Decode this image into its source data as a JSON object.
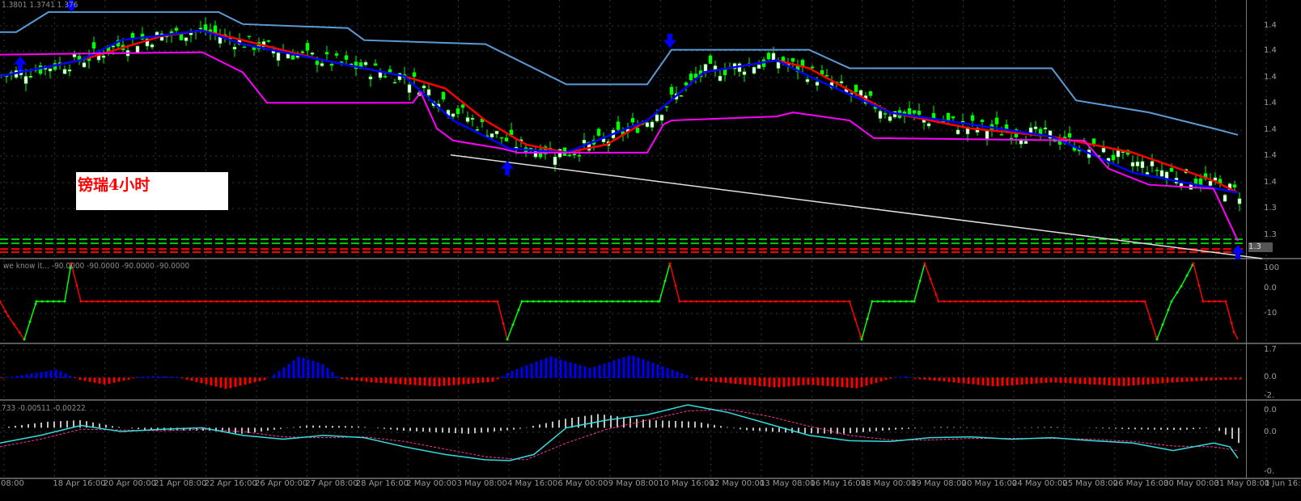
{
  "header": {
    "ohlc_text": "1.3801 1.3741 1.376"
  },
  "annotation": {
    "text": "镑瑞4小时"
  },
  "price_axis": {
    "labels": [
      "1.4",
      "1.4",
      "1.4",
      "1.4",
      "1.4",
      "1.4",
      "1.4",
      "1.3",
      "1.3"
    ],
    "current_price": "1.3"
  },
  "subwindow1": {
    "label": "we know it... -90.0000 -90.0000 -90.0000 -90.0000",
    "axis": [
      "100",
      "0.0",
      "-10"
    ]
  },
  "subwindow2": {
    "axis": [
      "1.7",
      "0.0",
      "-2."
    ]
  },
  "subwindow3": {
    "label": "733 -0.00511 -0.00222",
    "axis": [
      "0.0",
      "0.0",
      "-0."
    ]
  },
  "time_axis": [
    "08:00",
    "18 Apr 16:00",
    "20 Apr 00:00",
    "21 Apr 08:00",
    "22 Apr 16:00",
    "26 Apr 00:00",
    "27 Apr 08:00",
    "28 Apr 16:00",
    "2 May 00:00",
    "3 May 08:00",
    "4 May 16:00",
    "6 May 00:00",
    "9 May 08:00",
    "10 May 16:00",
    "12 May 00:00",
    "13 May 08:00",
    "16 May 16:00",
    "18 May 00:00",
    "19 May 08:00",
    "20 May 16:00",
    "24 May 00:00",
    "25 May 08:00",
    "26 May 16:00",
    "30 May 00:00",
    "31 May 08:00",
    "1 Jun 16:"
  ],
  "colors": {
    "upper_band": "#5b9bd5",
    "ma_fast": "#ff0000",
    "ma_slow": "#0000ff",
    "lower_band": "#ff00ff",
    "trendline": "#e0e0e0",
    "bull": "#00ff00",
    "bear": "#ffffff"
  },
  "chart_data": {
    "type": "line",
    "x_unit": "bar index",
    "series": [
      {
        "name": "upper_band",
        "points": [
          [
            0,
            1.422
          ],
          [
            2,
            1.422
          ],
          [
            6,
            1.427
          ],
          [
            27,
            1.427
          ],
          [
            30,
            1.424
          ],
          [
            43,
            1.423
          ],
          [
            45,
            1.42
          ],
          [
            60,
            1.419
          ],
          [
            70,
            1.409
          ],
          [
            80,
            1.409
          ],
          [
            83,
            1.4176
          ],
          [
            100,
            1.4176
          ],
          [
            105,
            1.413
          ],
          [
            130,
            1.413
          ],
          [
            133,
            1.405
          ],
          [
            142,
            1.402
          ],
          [
            150,
            1.398
          ],
          [
            153,
            1.3964
          ]
        ]
      },
      {
        "name": "ma_fast",
        "points": [
          [
            0,
            1.411
          ],
          [
            10,
            1.415
          ],
          [
            20,
            1.421
          ],
          [
            25,
            1.4224
          ],
          [
            30,
            1.42
          ],
          [
            40,
            1.415
          ],
          [
            50,
            1.411
          ],
          [
            55,
            1.408
          ],
          [
            60,
            1.4
          ],
          [
            65,
            1.394
          ],
          [
            70,
            1.392
          ],
          [
            75,
            1.394
          ],
          [
            80,
            1.4
          ],
          [
            87,
            1.412
          ],
          [
            96,
            1.415
          ],
          [
            100,
            1.413
          ],
          [
            110,
            1.402
          ],
          [
            120,
            1.398
          ],
          [
            130,
            1.396
          ],
          [
            140,
            1.392
          ],
          [
            150,
            1.385
          ],
          [
            153,
            1.382
          ]
        ]
      },
      {
        "name": "ma_slow",
        "points": [
          [
            0,
            1.411
          ],
          [
            10,
            1.415
          ],
          [
            15,
            1.42
          ],
          [
            25,
            1.4224
          ],
          [
            30,
            1.419
          ],
          [
            40,
            1.415
          ],
          [
            50,
            1.411
          ],
          [
            56,
            1.4
          ],
          [
            63,
            1.393
          ],
          [
            70,
            1.392
          ],
          [
            80,
            1.4
          ],
          [
            87,
            1.412
          ],
          [
            96,
            1.415
          ],
          [
            100,
            1.411
          ],
          [
            110,
            1.402
          ],
          [
            120,
            1.399
          ],
          [
            130,
            1.396
          ],
          [
            140,
            1.387
          ],
          [
            153,
            1.382
          ]
        ]
      },
      {
        "name": "lower_band",
        "points": [
          [
            0,
            1.4164
          ],
          [
            25,
            1.417
          ],
          [
            30,
            1.412
          ],
          [
            33,
            1.4044
          ],
          [
            51,
            1.4044
          ],
          [
            52,
            1.407
          ],
          [
            54,
            1.398
          ],
          [
            56,
            1.395
          ],
          [
            62,
            1.393
          ],
          [
            64,
            1.392
          ],
          [
            80,
            1.392
          ],
          [
            82,
            1.399
          ],
          [
            83,
            1.4
          ],
          [
            96,
            1.401
          ],
          [
            98,
            1.402
          ],
          [
            105,
            1.4
          ],
          [
            108,
            1.3956
          ],
          [
            134,
            1.395
          ],
          [
            137,
            1.388
          ],
          [
            142,
            1.384
          ],
          [
            150,
            1.383
          ],
          [
            153,
            1.37
          ]
        ]
      },
      {
        "name": "trendline",
        "points": [
          [
            55.7,
            1.3914
          ],
          [
            156,
            1.3656
          ]
        ]
      }
    ],
    "hlines": [
      {
        "price": 1.3704,
        "color": "#00cc00"
      },
      {
        "price": 1.3694,
        "color": "#00cc00"
      },
      {
        "price": 1.368,
        "color": "#ff0000"
      },
      {
        "price": 1.3672,
        "color": "#ff0000"
      }
    ],
    "arrows": [
      {
        "bar": 8.8,
        "price": 1.427,
        "dir": "down"
      },
      {
        "bar": 82.8,
        "price": 1.418,
        "dir": "down"
      },
      {
        "bar": 2.5,
        "price": 1.416,
        "dir": "up"
      },
      {
        "bar": 62.7,
        "price": 1.39,
        "dir": "up"
      },
      {
        "bar": 153,
        "price": 1.369,
        "dir": "up"
      }
    ],
    "ylim": [
      1.366,
      1.43
    ],
    "oscillator": {
      "points": [
        [
          0,
          0
        ],
        [
          1,
          -38
        ],
        [
          3,
          -100
        ],
        [
          4.5,
          0
        ],
        [
          8,
          0
        ],
        [
          8.8,
          100
        ],
        [
          10,
          0
        ],
        [
          61.5,
          0
        ],
        [
          62.7,
          -100
        ],
        [
          64.5,
          0
        ],
        [
          81.5,
          0
        ],
        [
          82.8,
          100
        ],
        [
          84,
          0
        ],
        [
          105,
          0
        ],
        [
          106.5,
          -100
        ],
        [
          107.8,
          0
        ],
        [
          113,
          0
        ],
        [
          114.3,
          100
        ],
        [
          116,
          0
        ],
        [
          141.5,
          0
        ],
        [
          143,
          -100
        ],
        [
          144.8,
          0
        ],
        [
          146,
          40
        ],
        [
          147.5,
          100
        ],
        [
          148.7,
          0
        ],
        [
          151.5,
          0
        ],
        [
          152.5,
          -80
        ],
        [
          153,
          -100
        ]
      ],
      "ylim": [
        -100,
        100
      ]
    },
    "histogram": {
      "points": [
        [
          0,
          -0.1
        ],
        [
          2,
          0.2
        ],
        [
          7,
          1.1
        ],
        [
          9,
          0.1
        ],
        [
          10,
          -0.3
        ],
        [
          13,
          -0.9
        ],
        [
          16,
          -0.2
        ],
        [
          17,
          0.1
        ],
        [
          19,
          0.2
        ],
        [
          22,
          0.1
        ],
        [
          23,
          -0.2
        ],
        [
          28,
          -1.5
        ],
        [
          33,
          -0.2
        ],
        [
          34,
          0.5
        ],
        [
          37,
          2.9
        ],
        [
          40,
          1.8
        ],
        [
          42,
          -0.1
        ],
        [
          46,
          -0.6
        ],
        [
          54,
          -1.15
        ],
        [
          61,
          -0.5
        ],
        [
          63,
          0.8
        ],
        [
          68,
          2.9
        ],
        [
          73,
          1.3
        ],
        [
          78,
          3.1
        ],
        [
          85,
          0.3
        ],
        [
          86,
          -0.3
        ],
        [
          96,
          -1.3
        ],
        [
          100,
          -0.9
        ],
        [
          106,
          -1.4
        ],
        [
          110,
          -0.1
        ],
        [
          112,
          0.2
        ],
        [
          113,
          -0.1
        ],
        [
          117,
          -0.5
        ],
        [
          123,
          -1.15
        ],
        [
          130,
          -0.6
        ],
        [
          139,
          -1.1
        ],
        [
          145,
          -0.6
        ],
        [
          150,
          -0.3
        ],
        [
          153,
          -0.2
        ]
      ],
      "ylim": [
        -2.5,
        4
      ]
    },
    "macd": {
      "main": [
        [
          0,
          -20
        ],
        [
          5,
          -10
        ],
        [
          10,
          3
        ],
        [
          15,
          -5
        ],
        [
          20,
          -2
        ],
        [
          25,
          0
        ],
        [
          30,
          -10
        ],
        [
          35,
          -15
        ],
        [
          40,
          -10
        ],
        [
          45,
          -13
        ],
        [
          50,
          -25
        ],
        [
          55,
          -35
        ],
        [
          60,
          -42
        ],
        [
          63,
          -43
        ],
        [
          66,
          -35
        ],
        [
          70,
          0
        ],
        [
          75,
          10
        ],
        [
          80,
          17
        ],
        [
          85,
          30
        ],
        [
          90,
          20
        ],
        [
          95,
          5
        ],
        [
          100,
          -10
        ],
        [
          105,
          -17
        ],
        [
          110,
          -18
        ],
        [
          115,
          -13
        ],
        [
          120,
          -12
        ],
        [
          125,
          -15
        ],
        [
          130,
          -13
        ],
        [
          135,
          -17
        ],
        [
          140,
          -20
        ],
        [
          145,
          -30
        ],
        [
          150,
          -20
        ],
        [
          152,
          -25
        ],
        [
          153,
          -40
        ]
      ],
      "signal": [
        [
          0,
          -25
        ],
        [
          5,
          -15
        ],
        [
          10,
          -2
        ],
        [
          15,
          -3
        ],
        [
          20,
          -4
        ],
        [
          25,
          -2
        ],
        [
          30,
          -5
        ],
        [
          35,
          -12
        ],
        [
          40,
          -13
        ],
        [
          45,
          -12
        ],
        [
          50,
          -18
        ],
        [
          55,
          -28
        ],
        [
          60,
          -38
        ],
        [
          65,
          -42
        ],
        [
          70,
          -20
        ],
        [
          75,
          -2
        ],
        [
          80,
          10
        ],
        [
          85,
          22
        ],
        [
          90,
          24
        ],
        [
          95,
          15
        ],
        [
          100,
          2
        ],
        [
          105,
          -10
        ],
        [
          110,
          -16
        ],
        [
          115,
          -16
        ],
        [
          120,
          -14
        ],
        [
          125,
          -14
        ],
        [
          130,
          -14
        ],
        [
          135,
          -15
        ],
        [
          140,
          -18
        ],
        [
          145,
          -24
        ],
        [
          150,
          -25
        ],
        [
          153,
          -30
        ]
      ],
      "bars": [
        [
          0,
          0
        ],
        [
          6,
          8
        ],
        [
          10,
          10
        ],
        [
          14,
          2
        ],
        [
          18,
          -3
        ],
        [
          26,
          -4
        ],
        [
          30,
          -8
        ],
        [
          38,
          3
        ],
        [
          44,
          2
        ],
        [
          50,
          -4
        ],
        [
          58,
          -8
        ],
        [
          64,
          -2
        ],
        [
          70,
          12
        ],
        [
          74,
          18
        ],
        [
          80,
          10
        ],
        [
          86,
          8
        ],
        [
          92,
          -3
        ],
        [
          98,
          -7
        ],
        [
          104,
          -8
        ],
        [
          110,
          -3
        ],
        [
          116,
          1
        ],
        [
          124,
          0
        ],
        [
          130,
          1
        ],
        [
          140,
          -2
        ],
        [
          146,
          -3
        ],
        [
          150,
          0
        ],
        [
          152,
          -12
        ],
        [
          153,
          -20
        ]
      ],
      "ylim": [
        -60,
        30
      ]
    }
  }
}
